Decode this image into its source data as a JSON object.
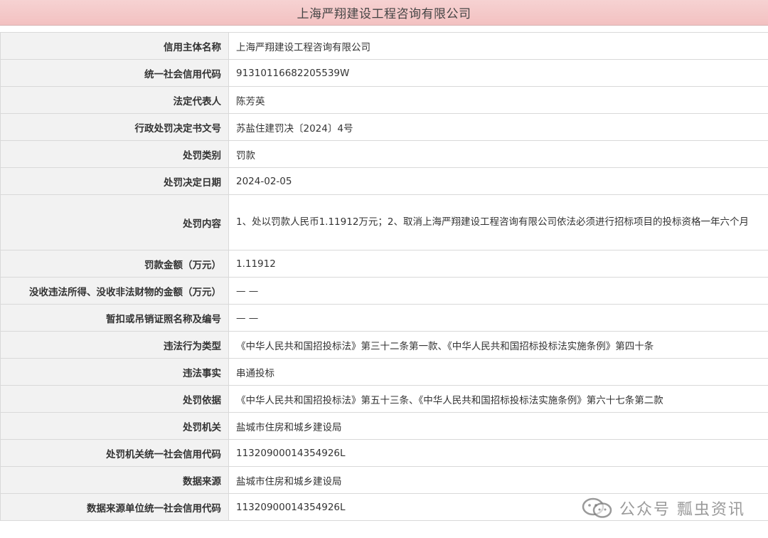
{
  "header": {
    "title": "上海严翔建设工程咨询有限公司"
  },
  "rows": [
    {
      "label": "信用主体名称",
      "value": "上海严翔建设工程咨询有限公司"
    },
    {
      "label": "统一社会信用代码",
      "value": "91310116682205539W"
    },
    {
      "label": "法定代表人",
      "value": "陈芳英"
    },
    {
      "label": "行政处罚决定书文号",
      "value": "苏盐住建罚决〔2024〕4号"
    },
    {
      "label": "处罚类别",
      "value": "罚款"
    },
    {
      "label": "处罚决定日期",
      "value": "2024-02-05"
    },
    {
      "label": "处罚内容",
      "value": "1、处以罚款人民币1.11912万元；2、取消上海严翔建设工程咨询有限公司依法必须进行招标项目的投标资格一年六个月"
    },
    {
      "label": "罚款金额（万元）",
      "value": "1.11912"
    },
    {
      "label": "没收违法所得、没收非法财物的金额（万元）",
      "value": "— —"
    },
    {
      "label": "暂扣或吊销证照名称及编号",
      "value": "— —"
    },
    {
      "label": "违法行为类型",
      "value": "《中华人民共和国招投标法》第三十二条第一款、《中华人民共和国招标投标法实施条例》第四十条"
    },
    {
      "label": "违法事实",
      "value": "串通投标"
    },
    {
      "label": "处罚依据",
      "value": "《中华人民共和国招投标法》第五十三条、《中华人民共和国招标投标法实施条例》第六十七条第二款"
    },
    {
      "label": "处罚机关",
      "value": "盐城市住房和城乡建设局"
    },
    {
      "label": "处罚机关统一社会信用代码",
      "value": "11320900014354926L"
    },
    {
      "label": "数据来源",
      "value": "盐城市住房和城乡建设局"
    },
    {
      "label": "数据来源单位统一社会信用代码",
      "value": "11320900014354926L"
    }
  ],
  "watermark": {
    "text": "公众号 瓢虫资讯",
    "icon": "wechat-icon"
  }
}
